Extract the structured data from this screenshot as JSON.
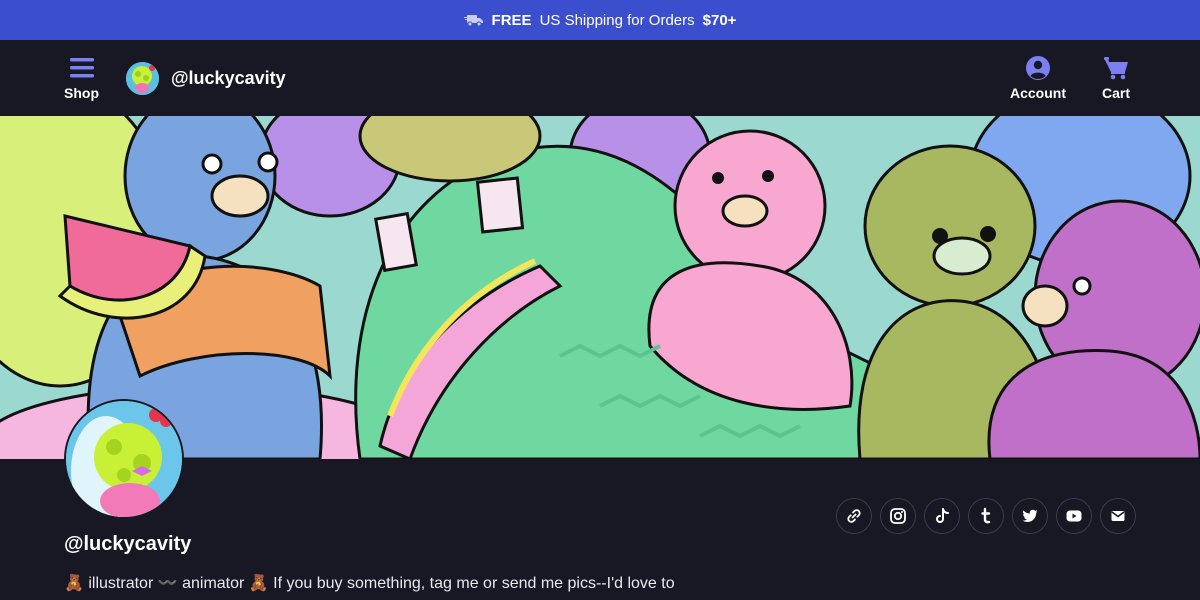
{
  "promo": {
    "free": "FREE",
    "text": "US Shipping for Orders",
    "amount": "$70+"
  },
  "nav": {
    "shop_label": "Shop",
    "brand_name": "@luckycavity",
    "account_label": "Account",
    "cart_label": "Cart"
  },
  "profile": {
    "handle": "@luckycavity",
    "bio": "🧸 illustrator 〰️ animator 🧸 If you buy something, tag me or send me pics--I'd love to"
  },
  "socials": [
    {
      "name": "link-icon"
    },
    {
      "name": "instagram-icon"
    },
    {
      "name": "tiktok-icon"
    },
    {
      "name": "tumblr-icon"
    },
    {
      "name": "twitter-icon"
    },
    {
      "name": "youtube-icon"
    },
    {
      "name": "email-icon"
    }
  ],
  "colors": {
    "promo_bg": "#3b4fce",
    "nav_bg": "#181825",
    "icon_accent": "#7c7ff0"
  }
}
